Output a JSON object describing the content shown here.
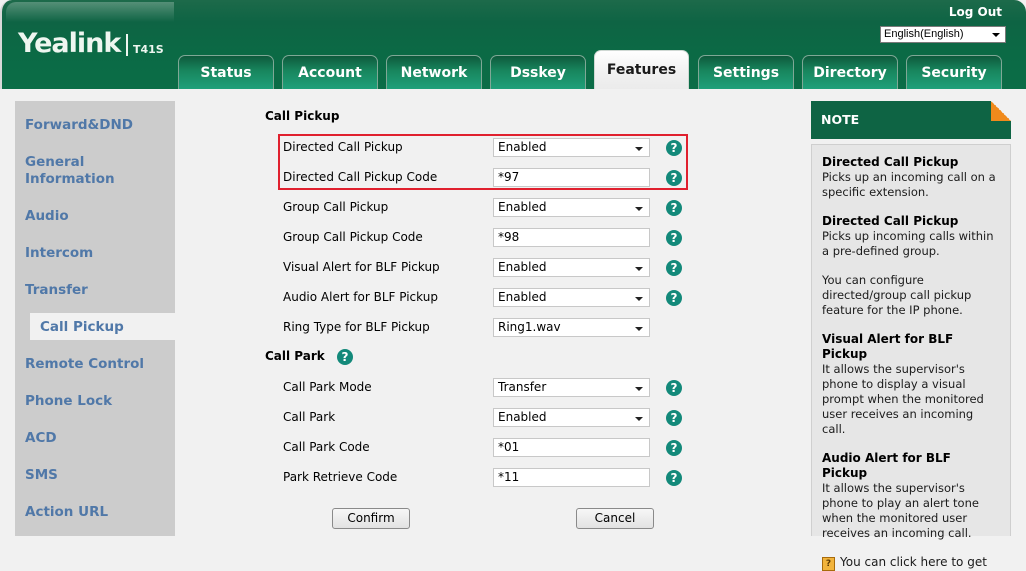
{
  "header": {
    "brand": "Yealink",
    "model": "T41S",
    "logout_label": "Log Out",
    "language": "English(English)"
  },
  "tabs": [
    {
      "label": "Status",
      "active": false
    },
    {
      "label": "Account",
      "active": false
    },
    {
      "label": "Network",
      "active": false
    },
    {
      "label": "Dsskey",
      "active": false
    },
    {
      "label": "Features",
      "active": true
    },
    {
      "label": "Settings",
      "active": false
    },
    {
      "label": "Directory",
      "active": false
    },
    {
      "label": "Security",
      "active": false
    }
  ],
  "sidebar": {
    "items": [
      {
        "label": "Forward&DND"
      },
      {
        "label": "General Information"
      },
      {
        "label": "Audio"
      },
      {
        "label": "Intercom"
      },
      {
        "label": "Transfer"
      },
      {
        "label": "Call Pickup",
        "active": true
      },
      {
        "label": "Remote Control"
      },
      {
        "label": "Phone Lock"
      },
      {
        "label": "ACD"
      },
      {
        "label": "SMS"
      },
      {
        "label": "Action URL"
      }
    ]
  },
  "form": {
    "call_pickup_title": "Call Pickup",
    "call_park_title": "Call Park",
    "rows": [
      {
        "label": "Directed Call Pickup",
        "type": "select",
        "value": "Enabled",
        "help": true
      },
      {
        "label": "Directed Call Pickup Code",
        "type": "input",
        "value": "*97",
        "help": true
      },
      {
        "label": "Group Call Pickup",
        "type": "select",
        "value": "Enabled",
        "help": true
      },
      {
        "label": "Group Call Pickup Code",
        "type": "input",
        "value": "*98",
        "help": true
      },
      {
        "label": "Visual Alert for BLF Pickup",
        "type": "select",
        "value": "Enabled",
        "help": true
      },
      {
        "label": "Audio Alert for BLF Pickup",
        "type": "select",
        "value": "Enabled",
        "help": true
      },
      {
        "label": "Ring Type for BLF Pickup",
        "type": "select",
        "value": "Ring1.wav",
        "help": false
      },
      {
        "label": "Call Park Mode",
        "type": "select",
        "value": "Transfer",
        "help": true
      },
      {
        "label": "Call Park",
        "type": "select",
        "value": "Enabled",
        "help": true
      },
      {
        "label": "Call Park Code",
        "type": "input",
        "value": "*01",
        "help": true
      },
      {
        "label": "Park Retrieve Code",
        "type": "input",
        "value": "*11",
        "help": true
      }
    ],
    "help_glyph": "?",
    "confirm_label": "Confirm",
    "cancel_label": "Cancel"
  },
  "note": {
    "title": "NOTE",
    "blocks": [
      {
        "title": "Directed Call Pickup",
        "text": "Picks up an incoming call on a specific extension."
      },
      {
        "title": "Directed Call Pickup",
        "text": "Picks up incoming calls within a pre-defined group."
      },
      {
        "title": "",
        "text": "You can configure directed/group call pickup feature for the IP phone."
      },
      {
        "title": "Visual Alert for BLF Pickup",
        "text": "It allows the supervisor's phone to display a visual prompt when the monitored user receives an incoming call."
      },
      {
        "title": "Audio Alert for BLF Pickup",
        "text": "It allows the supervisor's phone to play an alert tone when the monitored user receives an incoming call."
      }
    ],
    "link_icon": "?",
    "link_text": "You can click here to get"
  },
  "colors": {
    "brand_green": "#0e6444",
    "highlight_red": "#e0202e",
    "help_teal": "#13897a",
    "sidebar_link": "#5078a8",
    "note_corner": "#f08a1c"
  }
}
